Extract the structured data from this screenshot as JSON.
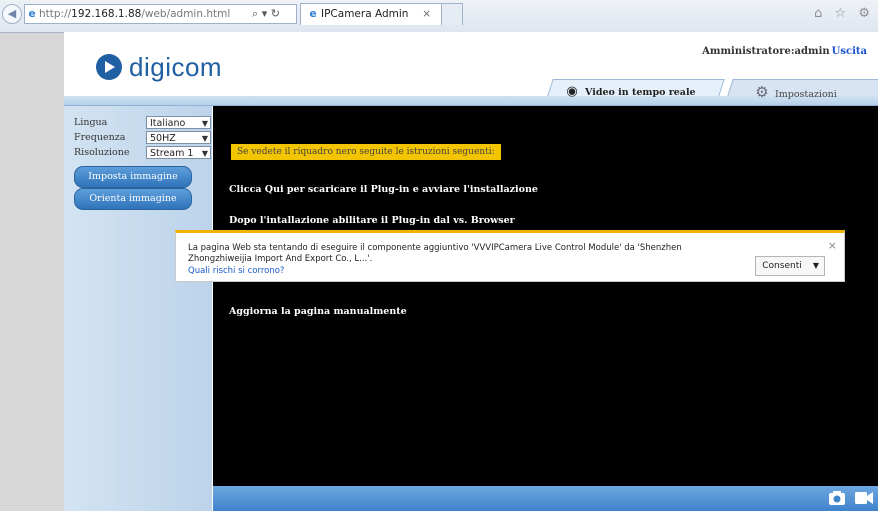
{
  "browser": {
    "url_scheme": "http://",
    "url_host": "192.168.1.88",
    "url_path": "/web/admin.html",
    "address_tools": "⌕ ▾ ↻",
    "tab_title": "IPCamera Admin",
    "tab_close": "×",
    "right_icons": "⌂ ☆ ⚙"
  },
  "header": {
    "logo_text": "digicom",
    "user_label": "Amministratore:admin",
    "logout_label": "Uscita"
  },
  "tabs": {
    "live_label": "Video in tempo reale",
    "settings_label": "Impostazioni"
  },
  "sidebar": {
    "rows": [
      {
        "label": "Lingua",
        "value": "Italiano"
      },
      {
        "label": "Frequenza",
        "value": "50HZ"
      },
      {
        "label": "Risoluzione",
        "value": "Stream 1"
      }
    ],
    "buttons": [
      {
        "label": "Imposta immagine"
      },
      {
        "label": "Orienta immagine"
      }
    ]
  },
  "video": {
    "warning": "Se vedete il riquadro nero seguite le istruzioni seguenti:",
    "step1": "Clicca Qui per scaricare il Plug-in e avviare l'installazione",
    "step2": "Dopo l'intallazione abilitare il Plug-in dal vs. Browser",
    "step3": "Aggiorna la pagina manualmente"
  },
  "infobar": {
    "message": "La pagina Web sta tentando di eseguire il componente aggiuntivo 'VVVIPCamera Live Control Module' da 'Shenzhen Zhongzhiweijia Import And Export Co., L...'.",
    "risk_link": "Quali rischi si corrono?",
    "allow_label": "Consenti",
    "close": "×"
  },
  "colors": {
    "brand_blue": "#1f5fa2",
    "button_blue": "#2f73b9",
    "warning_yellow": "#f3c400",
    "link_blue": "#1a4fcf"
  },
  "icons": {
    "back": "back-arrow-icon",
    "browser": "ie-logo-icon",
    "live_tab": "webcam-icon",
    "settings_tab": "gears-icon",
    "snapshot": "camera-icon",
    "record": "video-camera-icon"
  }
}
